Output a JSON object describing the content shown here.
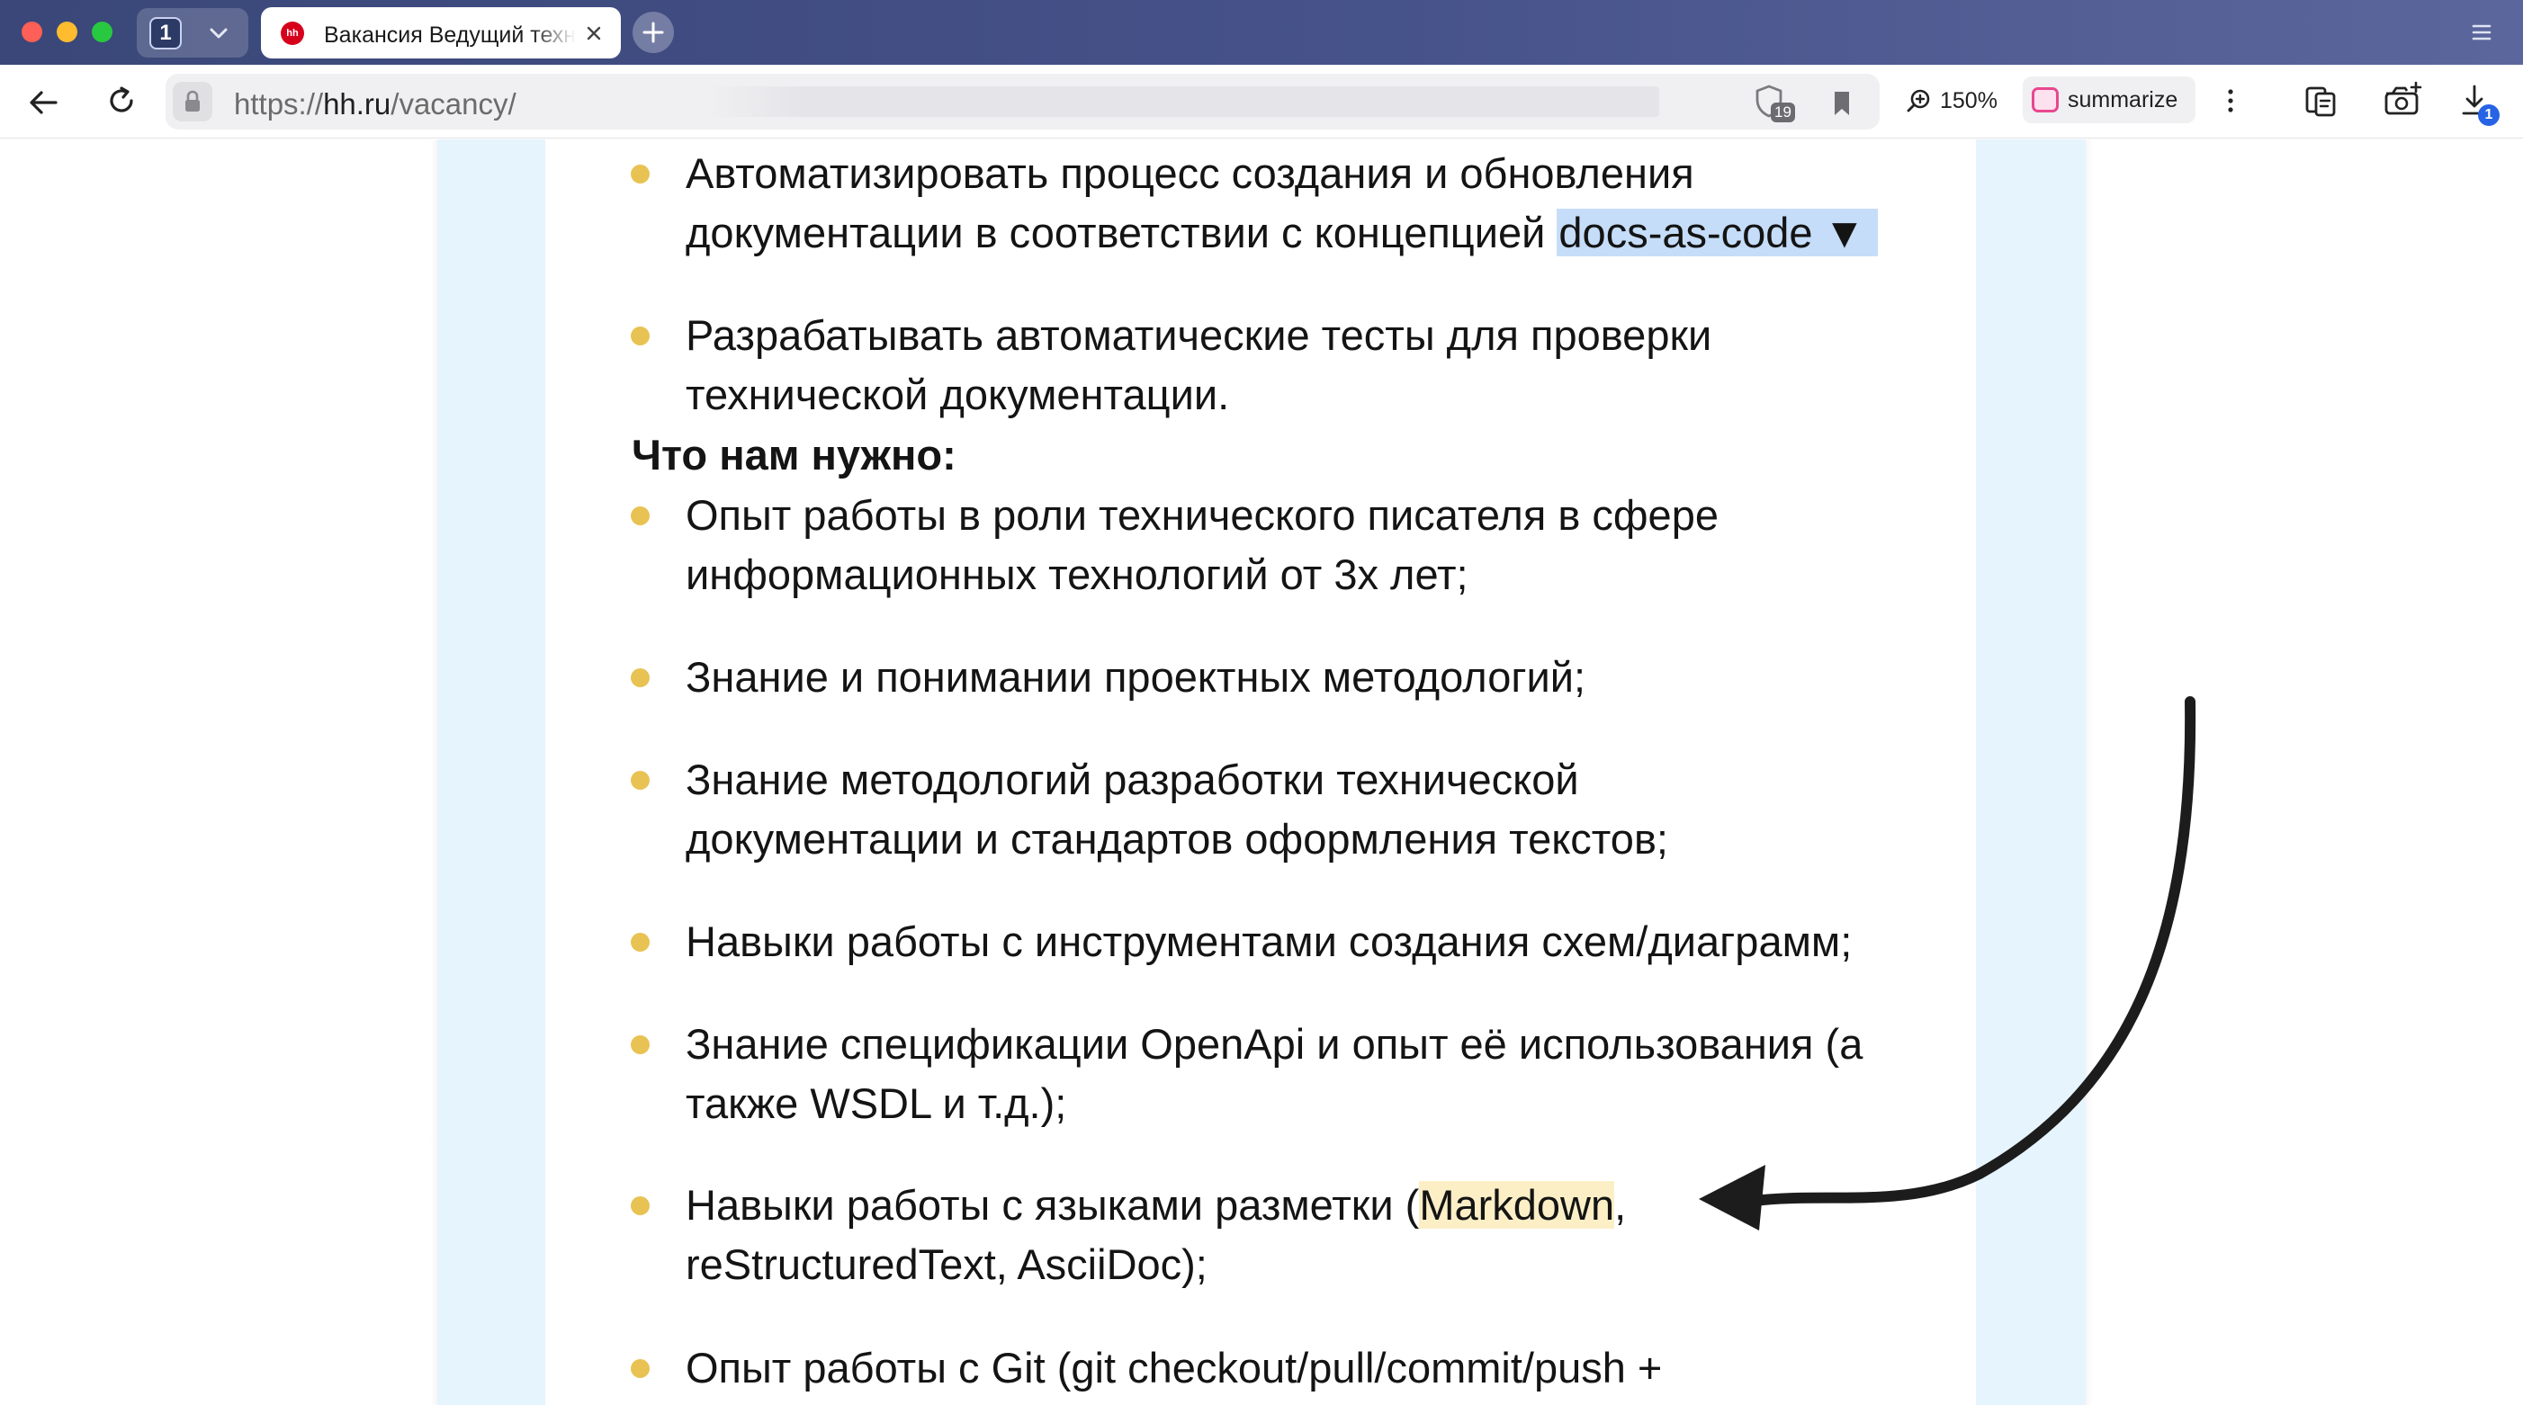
{
  "browser": {
    "tab_count": "1",
    "active_tab": {
      "title": "Вакансия Ведущий технический писатель",
      "favicon_text": "hh"
    },
    "url": {
      "scheme": "https://",
      "host": "hh.ru",
      "path": "/vacancy/"
    },
    "shield_badge": "19",
    "zoom": "150%",
    "summarize_label": "summarize",
    "downloads_badge": "1"
  },
  "page": {
    "items_top": [
      {
        "line1": "Автоматизировать процесс создания и обновления",
        "line2_before": "документации в соответствии с концепцией ",
        "line2_highlight": "docs-as-code",
        "line2_tail": "▼"
      },
      {
        "line1": "Разрабатывать автоматические тесты для проверки",
        "line2": "технической документации."
      }
    ],
    "section_heading": "Что нам нужно:",
    "requirements": [
      {
        "line1": "Опыт работы в роли технического писателя в сфере",
        "line2": "информационных технологий от 3х лет;"
      },
      {
        "line1": "Знание и понимании проектных методологий;"
      },
      {
        "line1": "Знание методологий разработки технической",
        "line2": "документации и стандартов оформления текстов;"
      },
      {
        "line1": "Навыки работы с инструментами создания схем/диаграмм;"
      },
      {
        "line1": "Знание спецификации OpenApi и опыт её использования (а",
        "line2": "также WSDL и т.д.);"
      },
      {
        "line1_before": "Навыки работы с языками разметки (",
        "line1_highlight": "Markdown",
        "line1_after": ",",
        "line2": "reStructuredText, AsciiDoc);"
      },
      {
        "line1": "Опыт работы с Git (git checkout/pull/commit/push +"
      }
    ]
  },
  "colors": {
    "bullet": "#e8c353",
    "side_band": "#e6f4fd",
    "selection": "#c5ddf8",
    "markdown_highlight": "#fcefc6",
    "arrow": "#1c1c1c"
  }
}
